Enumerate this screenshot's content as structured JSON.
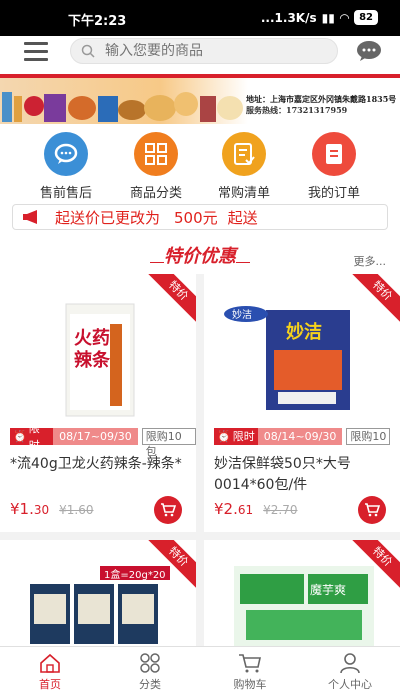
{
  "status": {
    "time": "下午2:23",
    "network": "...1.3K/s",
    "battery": "82"
  },
  "search": {
    "placeholder": "输入您要的商品"
  },
  "banner": {
    "address": "地址：上海市嘉定区外冈镇朱戴路1835号",
    "phone": "服务热线：17321317959"
  },
  "quick": [
    {
      "label": "售前售后",
      "icon": "headset-chat-icon",
      "color": "#3b8fd6"
    },
    {
      "label": "商品分类",
      "icon": "category-grid-icon",
      "color": "#f07d1e"
    },
    {
      "label": "常购清单",
      "icon": "checklist-icon",
      "color": "#f0a21e"
    },
    {
      "label": "我的订单",
      "icon": "order-document-icon",
      "color": "#ee4b3c"
    }
  ],
  "notice": {
    "prefix": "起送价已更改为",
    "amount": "500元",
    "suffix": "起送"
  },
  "special": {
    "title": "特价优惠",
    "more": "更多..."
  },
  "products": [
    {
      "tag": "特价",
      "limit_label": "限时",
      "dates": "08/17~09/30",
      "qty": "限购10包",
      "name": "*流40g卫龙火药辣条-辣条*",
      "price_int": "¥1.",
      "price_dec": "30",
      "old_price": "¥1.60"
    },
    {
      "tag": "特价",
      "limit_label": "限时",
      "dates": "08/14~09/30",
      "qty": "限购10",
      "name": "妙洁保鲜袋50只*大号0014*60包/件",
      "price_int": "¥2.",
      "price_dec": "61",
      "old_price": "¥2.70"
    },
    {
      "tag": "特价",
      "box_label": "1盒=20g*20"
    },
    {
      "tag": "特价"
    }
  ],
  "tabs": [
    {
      "label": "首页",
      "icon": "home-icon"
    },
    {
      "label": "分类",
      "icon": "category-icon"
    },
    {
      "label": "购物车",
      "icon": "cart-icon"
    },
    {
      "label": "个人中心",
      "icon": "user-icon"
    }
  ],
  "colors": {
    "accent": "#d8202b"
  }
}
